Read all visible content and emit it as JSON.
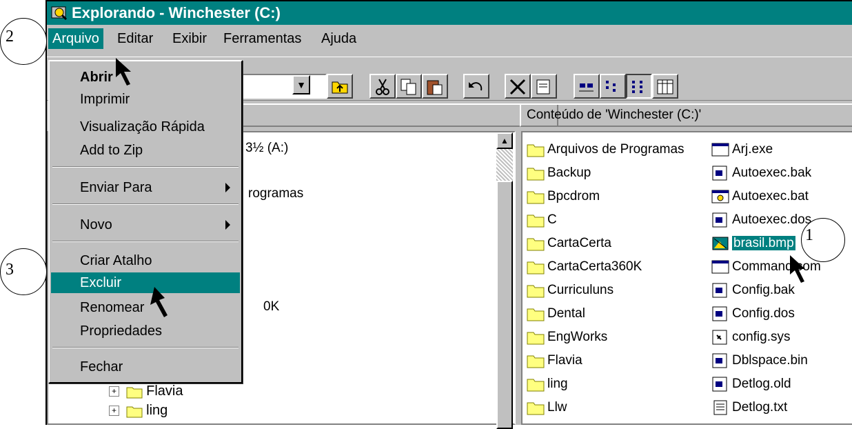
{
  "window": {
    "title": "Explorando - Winchester (C:)"
  },
  "menubar": {
    "items": [
      {
        "label": "Arquivo"
      },
      {
        "label": "Editar"
      },
      {
        "label": "Exibir"
      },
      {
        "label": "Ferramentas"
      },
      {
        "label": "Ajuda"
      }
    ]
  },
  "dropdown": {
    "items": [
      {
        "label": "Abrir"
      },
      {
        "label": "Imprimir"
      },
      {
        "label": "Visualização Rápida"
      },
      {
        "label": "Add to Zip"
      },
      {
        "label": "Enviar Para"
      },
      {
        "label": "Novo"
      },
      {
        "label": "Criar Atalho"
      },
      {
        "label": "Excluir"
      },
      {
        "label": "Renomear"
      },
      {
        "label": "Propriedades"
      },
      {
        "label": "Fechar"
      }
    ]
  },
  "leftpane": {
    "partial_texts": [
      "3½ (A:)",
      "rogramas",
      "0K"
    ],
    "tree": [
      {
        "label": "Flavia"
      },
      {
        "label": "ling"
      }
    ]
  },
  "rightpane": {
    "header": "Conteúdo de 'Winchester (C:)'",
    "col1": [
      "Arquivos de Programas",
      "Backup",
      "Bpcdrom",
      "C",
      "CartaCerta",
      "CartaCerta360K",
      "Curriculuns",
      "Dental",
      "EngWorks",
      "Flavia",
      "ling",
      "Llw"
    ],
    "col2": [
      "Arj.exe",
      "Autoexec.bak",
      "Autoexec.bat",
      "Autoexec.dos",
      "brasil.bmp",
      "Command.com",
      "Config.bak",
      "Config.dos",
      "config.sys",
      "Dblspace.bin",
      "Detlog.old",
      "Detlog.txt"
    ]
  },
  "annotations": {
    "n1": "1",
    "n2": "2",
    "n3": "3"
  }
}
